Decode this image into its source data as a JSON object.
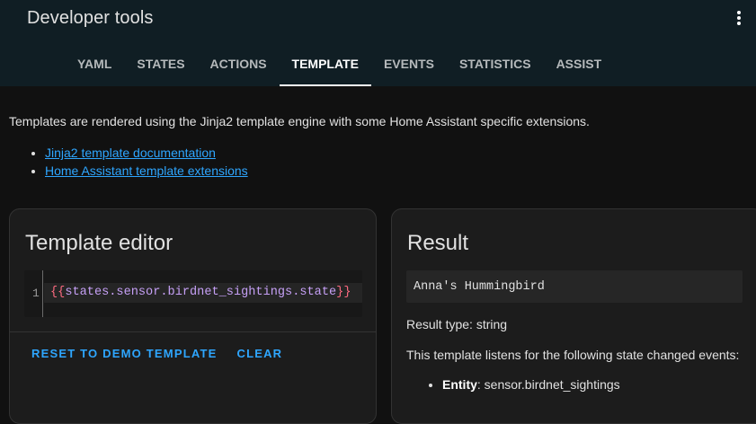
{
  "app": {
    "title": "Developer tools",
    "menu_icon": "more-vertical-icon"
  },
  "tabs": [
    {
      "label": "YAML",
      "active": false
    },
    {
      "label": "STATES",
      "active": false
    },
    {
      "label": "ACTIONS",
      "active": false
    },
    {
      "label": "TEMPLATE",
      "active": true
    },
    {
      "label": "EVENTS",
      "active": false
    },
    {
      "label": "STATISTICS",
      "active": false
    },
    {
      "label": "ASSIST",
      "active": false
    }
  ],
  "intro": {
    "text": "Templates are rendered using the Jinja2 template engine with some Home Assistant specific extensions.",
    "links": [
      "Jinja2 template documentation",
      "Home Assistant template extensions"
    ]
  },
  "editor": {
    "title": "Template editor",
    "line_number": "1",
    "code_open": "{{",
    "code_expr": "states.sensor.birdnet_sightings.state",
    "code_close": "}}",
    "reset_label": "RESET TO DEMO TEMPLATE",
    "clear_label": "CLEAR"
  },
  "result": {
    "title": "Result",
    "value": "Anna's Hummingbird",
    "type_text": "Result type: string",
    "listens_text": "This template listens for the following state changed events:",
    "entity_label": "Entity",
    "entity_value": ": sensor.birdnet_sightings"
  },
  "colors": {
    "header_bg": "#101e24",
    "page_bg": "#111111",
    "card_bg": "#1c1c1c",
    "link": "#2ea6ff",
    "code_brace": "#ff6b81",
    "code_expr": "#c6a0f6"
  }
}
